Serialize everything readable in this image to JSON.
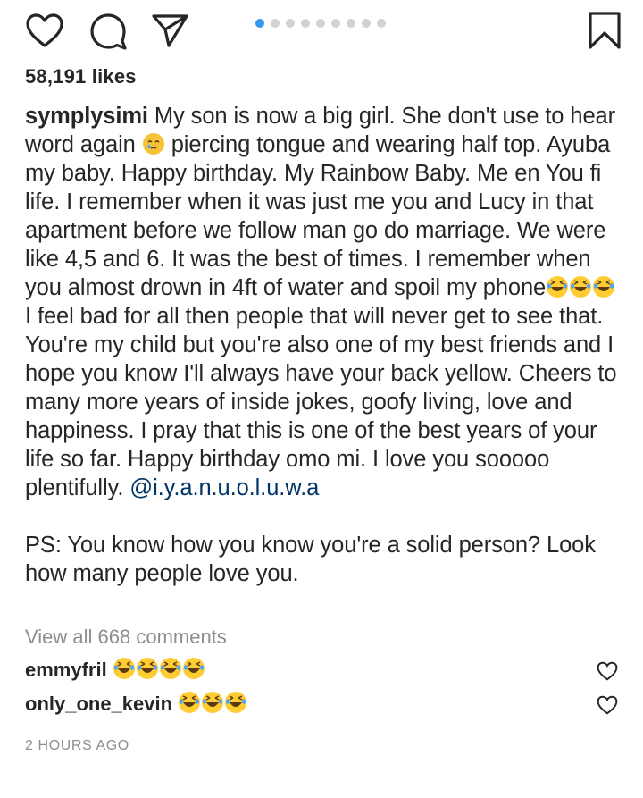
{
  "post": {
    "likes": "58,191 likes",
    "carousel": {
      "count": 9,
      "active": 0
    },
    "caption": {
      "username": "symplysimi",
      "seg1": " My son is now a big girl. She don't use to hear word again ",
      "seg2": " piercing tongue and wearing half top. Ayuba my baby. Happy birthday. My Rainbow Baby. Me en You fi life. I remember when it was just me you and Lucy in that apartment before we follow man go do marriage. We were like 4,5 and 6. It was the best of times. I remember when you almost drown in 4ft of water and spoil my phone",
      "seg3": " I feel bad for all then people that will never get to see that. You're my child but you're also one of my best friends and I hope you know I'll always have your back yellow. Cheers to many more years of inside jokes, goofy living, love and happiness. I pray that this is one of the best years of your life so far. Happy birthday omo mi. I love you sooooo plentifully. ",
      "mention": "@i.y.a.n.u.o.l.u.w.a",
      "ps": "PS: You know how you know you're a solid person? Look how many people love you."
    },
    "view_all_comments": "View all 668 comments",
    "comments": [
      {
        "username": "emmyfril",
        "emoji_icon": "laughing-tears-emoji",
        "emoji_count": 4
      },
      {
        "username": "only_one_kevin",
        "emoji_icon": "laughing-tears-emoji",
        "emoji_count": 3
      }
    ],
    "timestamp": "2 HOURS AGO"
  },
  "colors": {
    "text": "#262626",
    "muted": "#8e8e8e",
    "mention": "#003569",
    "carousel_active": "#3897f0",
    "carousel_inactive": "#d2d2d2",
    "emoji": "#ffcc33"
  },
  "icons": {
    "like": "heart-icon",
    "comment": "comment-bubble-icon",
    "share": "paper-plane-icon",
    "save": "bookmark-icon"
  }
}
